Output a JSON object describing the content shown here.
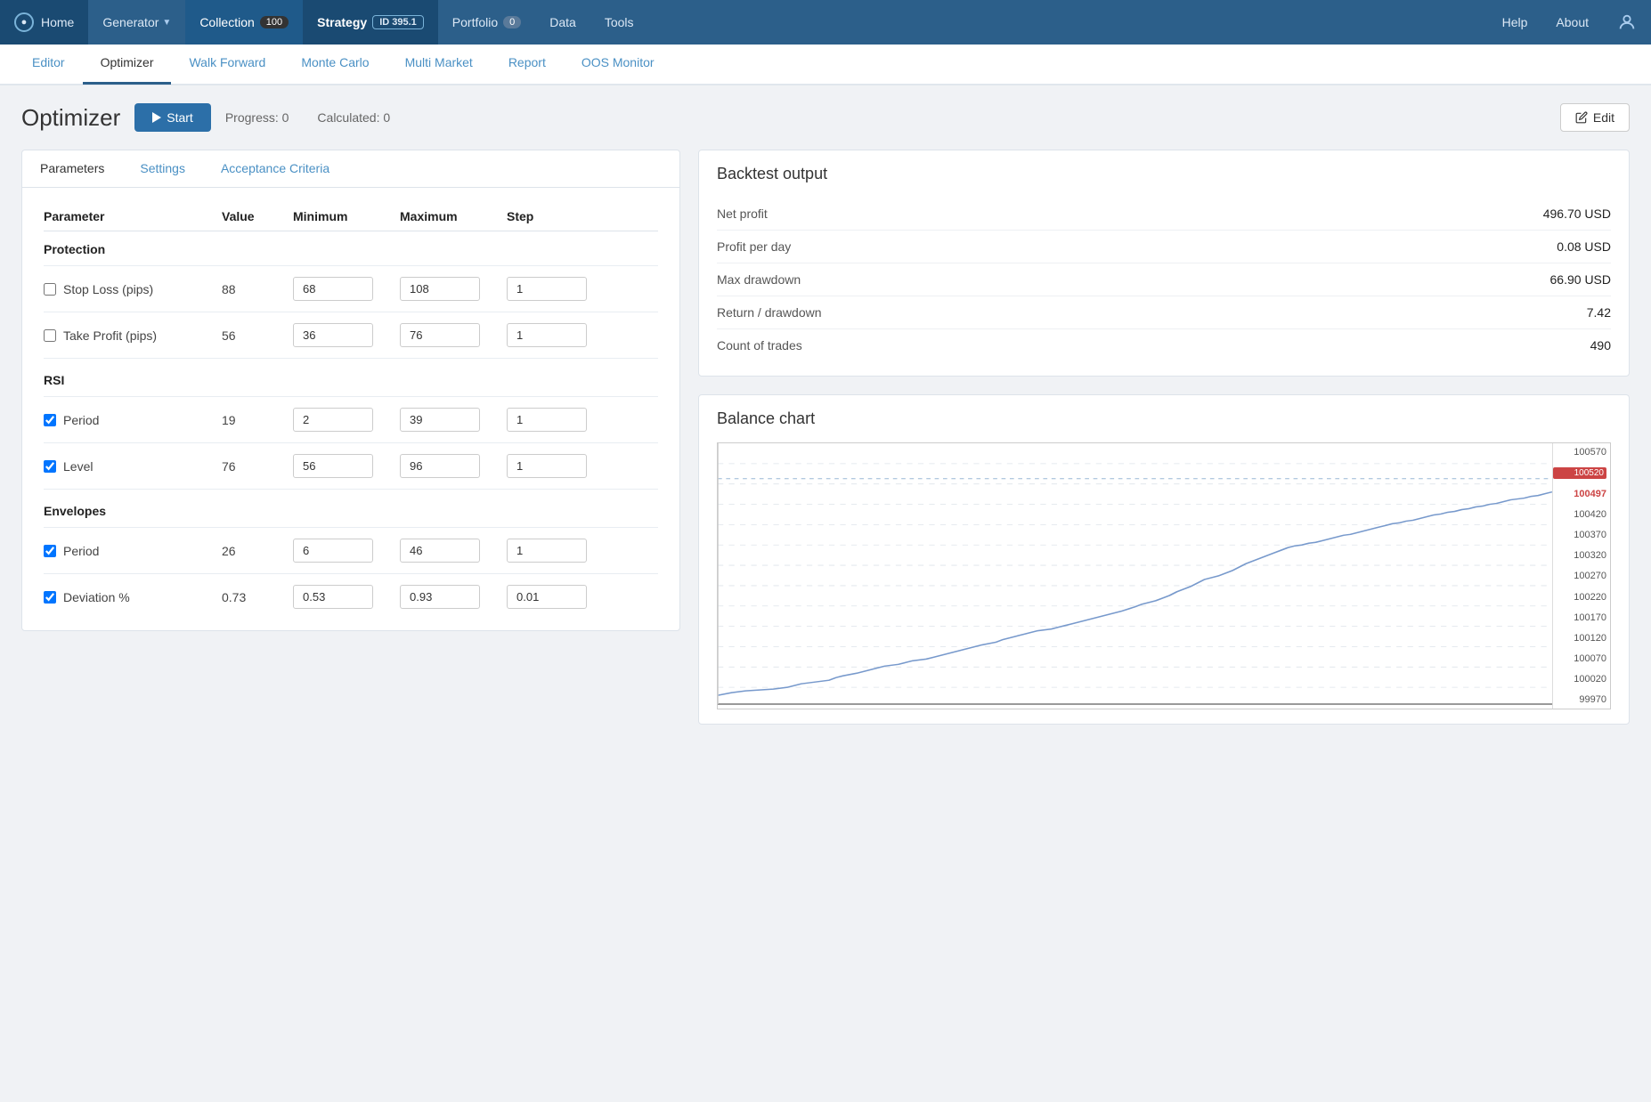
{
  "nav": {
    "home_label": "Home",
    "generator_label": "Generator",
    "collection_label": "Collection",
    "collection_badge": "100",
    "strategy_label": "Strategy",
    "strategy_badge": "ID 395.1",
    "portfolio_label": "Portfolio",
    "portfolio_badge": "0",
    "data_label": "Data",
    "tools_label": "Tools",
    "help_label": "Help",
    "about_label": "About"
  },
  "subnav": {
    "editor": "Editor",
    "optimizer": "Optimizer",
    "walk_forward": "Walk Forward",
    "monte_carlo": "Monte Carlo",
    "multi_market": "Multi Market",
    "report": "Report",
    "oos_monitor": "OOS Monitor"
  },
  "page": {
    "title": "Optimizer",
    "start_label": "Start",
    "progress_label": "Progress: 0",
    "calculated_label": "Calculated: 0",
    "edit_label": "Edit"
  },
  "tabs": {
    "parameters": "Parameters",
    "settings": "Settings",
    "acceptance_criteria": "Acceptance Criteria"
  },
  "table": {
    "col_parameter": "Parameter",
    "col_value": "Value",
    "col_minimum": "Minimum",
    "col_maximum": "Maximum",
    "col_step": "Step",
    "protection_header": "Protection",
    "rsi_header": "RSI",
    "envelopes_header": "Envelopes",
    "rows": [
      {
        "section": "Protection",
        "label": "Stop Loss (pips)",
        "checked": false,
        "value": "88",
        "minimum": "68",
        "maximum": "108",
        "step": "1"
      },
      {
        "section": "Protection",
        "label": "Take Profit (pips)",
        "checked": false,
        "value": "56",
        "minimum": "36",
        "maximum": "76",
        "step": "1"
      },
      {
        "section": "RSI",
        "label": "Period",
        "checked": true,
        "value": "19",
        "minimum": "2",
        "maximum": "39",
        "step": "1"
      },
      {
        "section": "RSI",
        "label": "Level",
        "checked": true,
        "value": "76",
        "minimum": "56",
        "maximum": "96",
        "step": "1"
      },
      {
        "section": "Envelopes",
        "label": "Period",
        "checked": true,
        "value": "26",
        "minimum": "6",
        "maximum": "46",
        "step": "1"
      },
      {
        "section": "Envelopes",
        "label": "Deviation %",
        "checked": true,
        "value": "0.73",
        "minimum": "0.53",
        "maximum": "0.93",
        "step": "0.01"
      }
    ]
  },
  "backtest": {
    "title": "Backtest output",
    "rows": [
      {
        "label": "Net profit",
        "value": "496.70 USD"
      },
      {
        "label": "Profit per day",
        "value": "0.08 USD"
      },
      {
        "label": "Max drawdown",
        "value": "66.90 USD"
      },
      {
        "label": "Return / drawdown",
        "value": "7.42"
      },
      {
        "label": "Count of trades",
        "value": "490"
      }
    ]
  },
  "chart": {
    "title": "Balance chart",
    "y_labels": [
      "100570",
      "100520",
      "100497",
      "100420",
      "100370",
      "100320",
      "100270",
      "100220",
      "100170",
      "100120",
      "100070",
      "100020",
      "99970"
    ]
  }
}
